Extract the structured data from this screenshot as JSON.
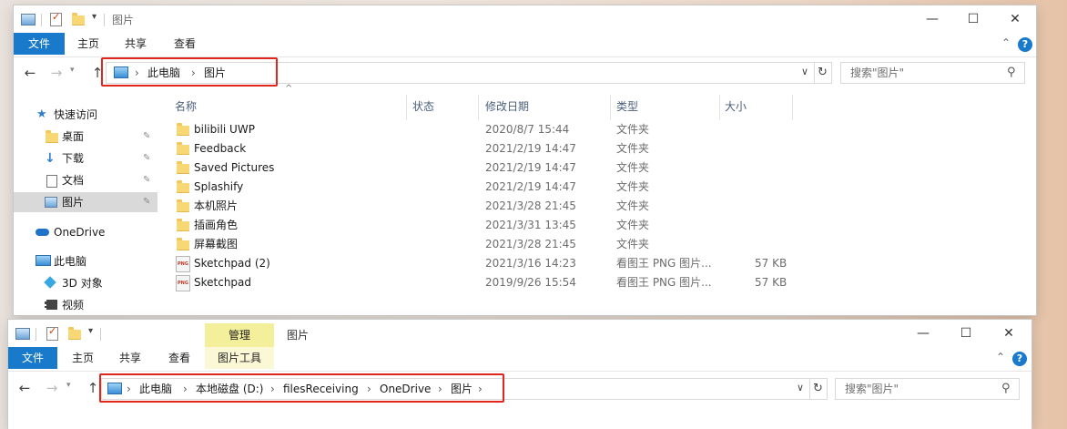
{
  "window_top": {
    "title": "图片",
    "ribbon_tabs": [
      "文件",
      "主页",
      "共享",
      "查看"
    ],
    "breadcrumb": [
      "此电脑",
      "图片"
    ],
    "search_placeholder": "搜索\"图片\"",
    "sidebar": [
      {
        "label": "快速访问",
        "icon": "star-icon",
        "pinned": false
      },
      {
        "label": "桌面",
        "icon": "folder-icon",
        "pinned": true
      },
      {
        "label": "下载",
        "icon": "download-icon",
        "pinned": true
      },
      {
        "label": "文档",
        "icon": "document-icon",
        "pinned": true
      },
      {
        "label": "图片",
        "icon": "pictures-icon",
        "pinned": true,
        "selected": true
      },
      {
        "label": "OneDrive",
        "icon": "cloud-icon",
        "pinned": false
      },
      {
        "label": "此电脑",
        "icon": "computer-icon",
        "pinned": false
      },
      {
        "label": "3D 对象",
        "icon": "cube-icon",
        "pinned": false
      },
      {
        "label": "视频",
        "icon": "video-icon",
        "pinned": false
      }
    ],
    "columns": [
      "名称",
      "状态",
      "修改日期",
      "类型",
      "大小"
    ],
    "rows": [
      {
        "name": "bilibili UWP",
        "date": "2020/8/7 15:44",
        "type": "文件夹",
        "size": "",
        "kind": "folder"
      },
      {
        "name": "Feedback",
        "date": "2021/2/19 14:47",
        "type": "文件夹",
        "size": "",
        "kind": "folder"
      },
      {
        "name": "Saved Pictures",
        "date": "2021/2/19 14:47",
        "type": "文件夹",
        "size": "",
        "kind": "folder"
      },
      {
        "name": "Splashify",
        "date": "2021/2/19 14:47",
        "type": "文件夹",
        "size": "",
        "kind": "folder"
      },
      {
        "name": "本机照片",
        "date": "2021/3/28 21:45",
        "type": "文件夹",
        "size": "",
        "kind": "folder"
      },
      {
        "name": "插画角色",
        "date": "2021/3/31 13:45",
        "type": "文件夹",
        "size": "",
        "kind": "folder"
      },
      {
        "name": "屏幕截图",
        "date": "2021/3/28 21:45",
        "type": "文件夹",
        "size": "",
        "kind": "folder"
      },
      {
        "name": "Sketchpad (2)",
        "date": "2021/3/16 14:23",
        "type": "看图王 PNG 图片...",
        "size": "57 KB",
        "kind": "png"
      },
      {
        "name": "Sketchpad",
        "date": "2019/9/26 15:54",
        "type": "看图王 PNG 图片...",
        "size": "57 KB",
        "kind": "png"
      }
    ],
    "png_badge": "PNG"
  },
  "window_bottom": {
    "title": "图片",
    "contextual_group": "管理",
    "ribbon_tabs": [
      "文件",
      "主页",
      "共享",
      "查看",
      "图片工具"
    ],
    "breadcrumb": [
      "此电脑",
      "本地磁盘 (D:)",
      "filesReceiving",
      "OneDrive",
      "图片"
    ],
    "search_placeholder": "搜索\"图片\""
  },
  "glyphs": {
    "minimize": "—",
    "maximize": "☐",
    "close": "✕",
    "back": "←",
    "forward": "→",
    "up": "↑",
    "refresh": "↻",
    "dropdown": "⌄",
    "search": "⚲",
    "chevron_right": "›",
    "collapse": "⌃",
    "help": "?",
    "pin": "📌",
    "sort_up": "^"
  },
  "colors": {
    "accent": "#1979ca",
    "highlight_outline": "#e0261d",
    "contextual_tab": "#f4ef9a"
  }
}
